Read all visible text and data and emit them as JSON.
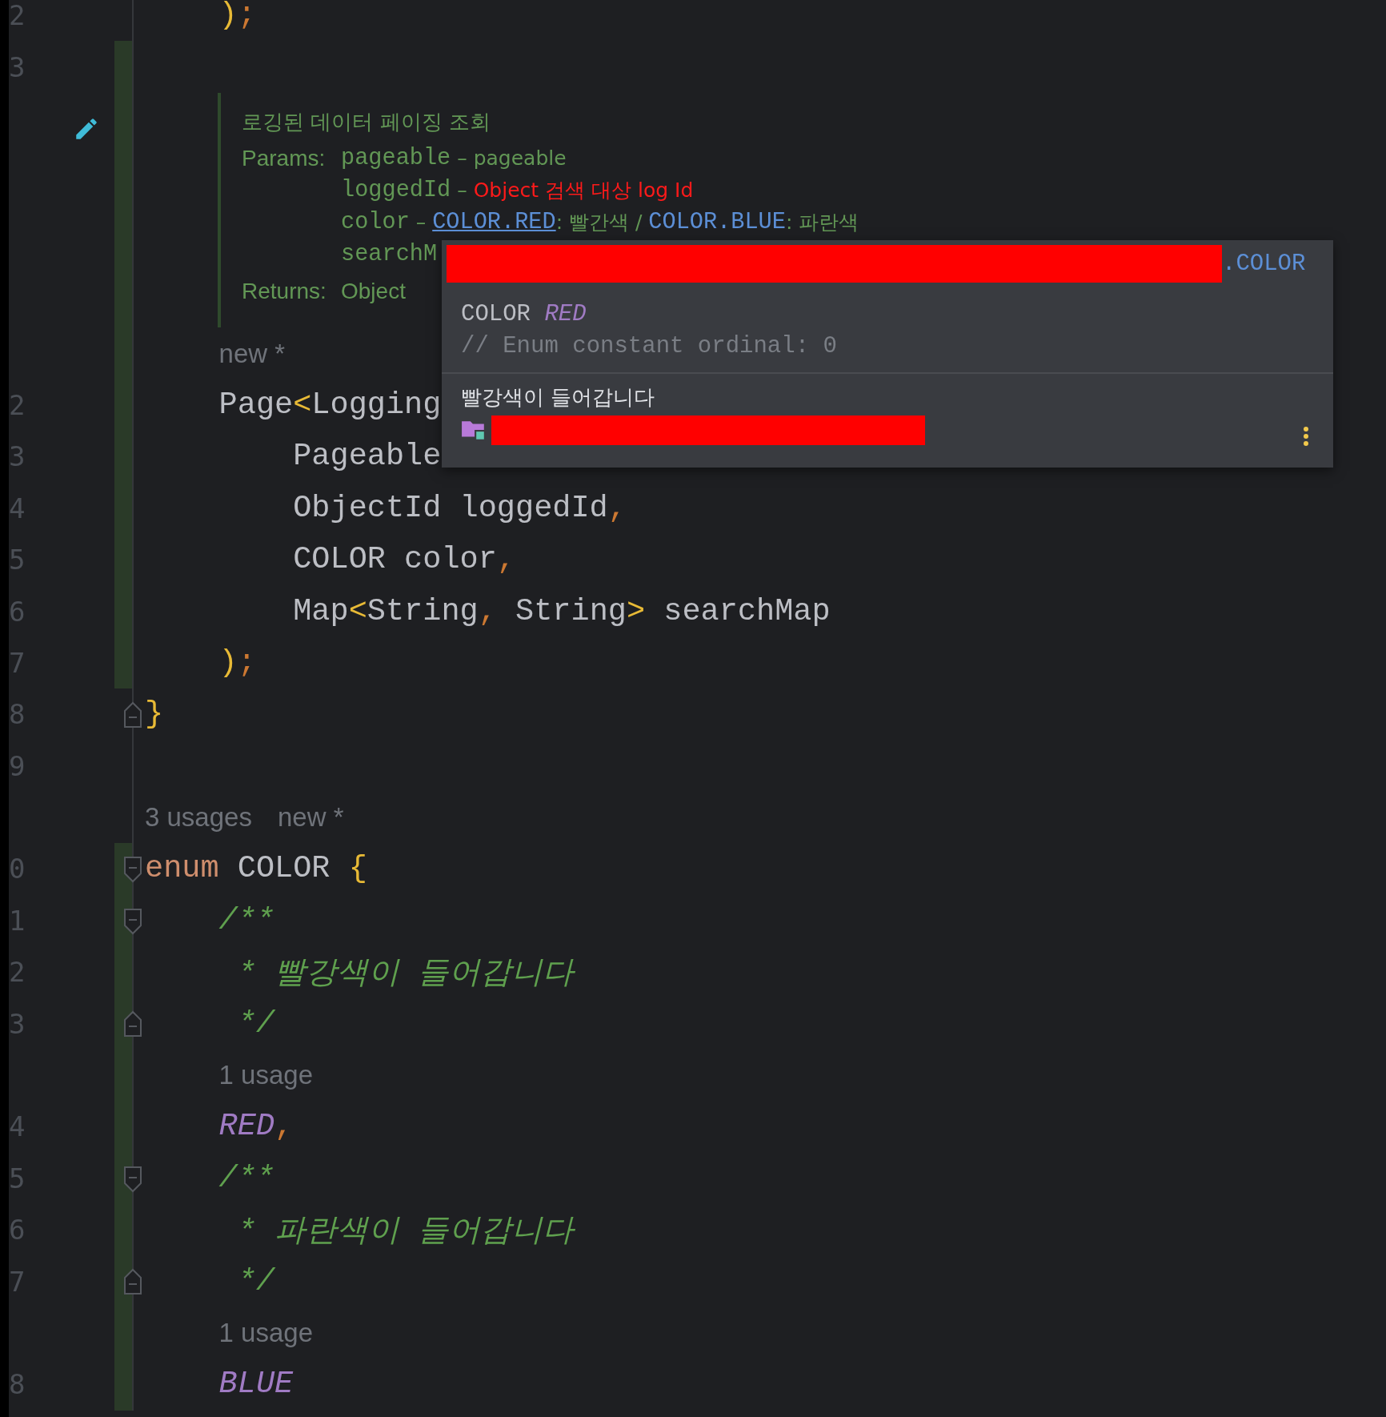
{
  "lines": [
    {
      "kind": "block",
      "children": [
        {
          "kind": "code",
          "number": "2",
          "changed": false,
          "tokens": [
            {
              "text": ")",
              "kind": "bracket"
            },
            {
              "text": ";",
              "kind": "punct"
            }
          ]
        },
        {
          "kind": "blank",
          "number": "3",
          "changed": true
        },
        {
          "kind": "doc",
          "changed": true,
          "summary": "로깅된 데이터 페이징 조회",
          "params_label": "Params:",
          "params": [
            [
              {
                "text": "pageable",
                "kind": "code"
              },
              {
                "text": " – pageable",
                "kind": "text"
              }
            ],
            [
              {
                "text": "loggedId",
                "kind": "code"
              },
              {
                "text": " – ",
                "kind": "text"
              },
              {
                "text": "Object 검색 대상 log Id",
                "kind": "error"
              }
            ],
            [
              {
                "text": "color",
                "kind": "code"
              },
              {
                "text": " – ",
                "kind": "text"
              },
              {
                "text": "COLOR.RED",
                "kind": "link"
              },
              {
                "text": ": 빨간색 / ",
                "kind": "text"
              },
              {
                "text": "COLOR.BLUE",
                "kind": "ref"
              },
              {
                "text": ": 파란색",
                "kind": "text"
              }
            ],
            [
              {
                "text": "searchM",
                "kind": "code"
              }
            ]
          ],
          "returns_label": "Returns:",
          "returns": "Object"
        },
        {
          "kind": "inlay",
          "changed": true,
          "texts": [
            "new *"
          ]
        },
        {
          "kind": "code",
          "number": "2",
          "changed": true,
          "tokens": [
            {
              "text": "Page",
              "kind": "plain"
            },
            {
              "text": "<",
              "kind": "bracket"
            },
            {
              "text": "Logging",
              "kind": "plain"
            }
          ],
          "children": [
            {
              "kind": "code",
              "number": "3",
              "changed": true,
              "tokens": [
                {
                  "text": "Pageable",
                  "kind": "plain"
                }
              ]
            },
            {
              "kind": "code",
              "number": "4",
              "changed": true,
              "tokens": [
                {
                  "text": "ObjectId loggedId",
                  "kind": "plain"
                },
                {
                  "text": ",",
                  "kind": "punct"
                }
              ]
            },
            {
              "kind": "code",
              "number": "5",
              "changed": true,
              "tokens": [
                {
                  "text": "COLOR color",
                  "kind": "plain"
                },
                {
                  "text": ",",
                  "kind": "punct"
                }
              ]
            },
            {
              "kind": "code",
              "number": "6",
              "changed": true,
              "tokens": [
                {
                  "text": "Map",
                  "kind": "plain"
                },
                {
                  "text": "<",
                  "kind": "bracket"
                },
                {
                  "text": "String",
                  "kind": "plain"
                },
                {
                  "text": ",",
                  "kind": "punct"
                },
                {
                  "text": " String",
                  "kind": "plain"
                },
                {
                  "text": ">",
                  "kind": "bracket"
                },
                {
                  "text": " searchMap",
                  "kind": "plain"
                }
              ]
            }
          ]
        },
        {
          "kind": "code",
          "number": "7",
          "changed": true,
          "tokens": [
            {
              "text": ")",
              "kind": "bracket"
            },
            {
              "text": ";",
              "kind": "punct"
            }
          ]
        }
      ]
    },
    {
      "kind": "code",
      "number": "8",
      "changed": false,
      "fold_end": true,
      "tokens": [
        {
          "text": "}",
          "kind": "bracket"
        }
      ]
    },
    {
      "kind": "blank",
      "number": "9",
      "changed": false
    },
    {
      "kind": "inlay",
      "changed": false,
      "texts": [
        "3 usages",
        "new *"
      ]
    },
    {
      "kind": "code",
      "number": "0",
      "changed": true,
      "fold_start": true,
      "tokens": [
        {
          "text": "enum",
          "kind": "keyword"
        },
        {
          "text": " COLOR ",
          "kind": "plain"
        },
        {
          "text": "{",
          "kind": "bracket"
        }
      ],
      "children": [
        {
          "kind": "code",
          "number": "1",
          "changed": true,
          "fold_start": true,
          "tokens": [
            {
              "text": "/**",
              "kind": "comment"
            }
          ]
        },
        {
          "kind": "code",
          "number": "2",
          "changed": true,
          "tokens": [
            {
              "text": " * 빨강색이 들어갑니다",
              "kind": "comment"
            }
          ]
        },
        {
          "kind": "code",
          "number": "3",
          "changed": true,
          "fold_end": true,
          "tokens": [
            {
              "text": " */",
              "kind": "comment"
            }
          ]
        },
        {
          "kind": "inlay",
          "changed": true,
          "texts": [
            "1 usage"
          ]
        },
        {
          "kind": "code",
          "number": "4",
          "changed": true,
          "tokens": [
            {
              "text": "RED",
              "kind": "constant"
            },
            {
              "text": ",",
              "kind": "punct"
            }
          ]
        },
        {
          "kind": "code",
          "number": "5",
          "changed": true,
          "fold_start": true,
          "tokens": [
            {
              "text": "/**",
              "kind": "comment"
            }
          ]
        },
        {
          "kind": "code",
          "number": "6",
          "changed": true,
          "tokens": [
            {
              "text": " * 파란색이 들어갑니다",
              "kind": "comment"
            }
          ]
        },
        {
          "kind": "code",
          "number": "7",
          "changed": true,
          "fold_end": true,
          "tokens": [
            {
              "text": " */",
              "kind": "comment"
            }
          ]
        },
        {
          "kind": "inlay",
          "changed": true,
          "texts": [
            "1 usage"
          ]
        },
        {
          "kind": "code",
          "number": "8",
          "changed": true,
          "tokens": [
            {
              "text": "BLUE",
              "kind": "constant"
            }
          ]
        }
      ]
    }
  ],
  "popup": {
    "header": {
      "redacted": true,
      "suffix": ".COLOR"
    },
    "signature": [
      {
        "text": "COLOR",
        "kind": "type"
      },
      {
        "text": "RED",
        "kind": "constant"
      }
    ],
    "comment": "// Enum constant ordinal: 0",
    "description": "빨강색이 들어갑니다",
    "source": {
      "redacted": true
    }
  }
}
